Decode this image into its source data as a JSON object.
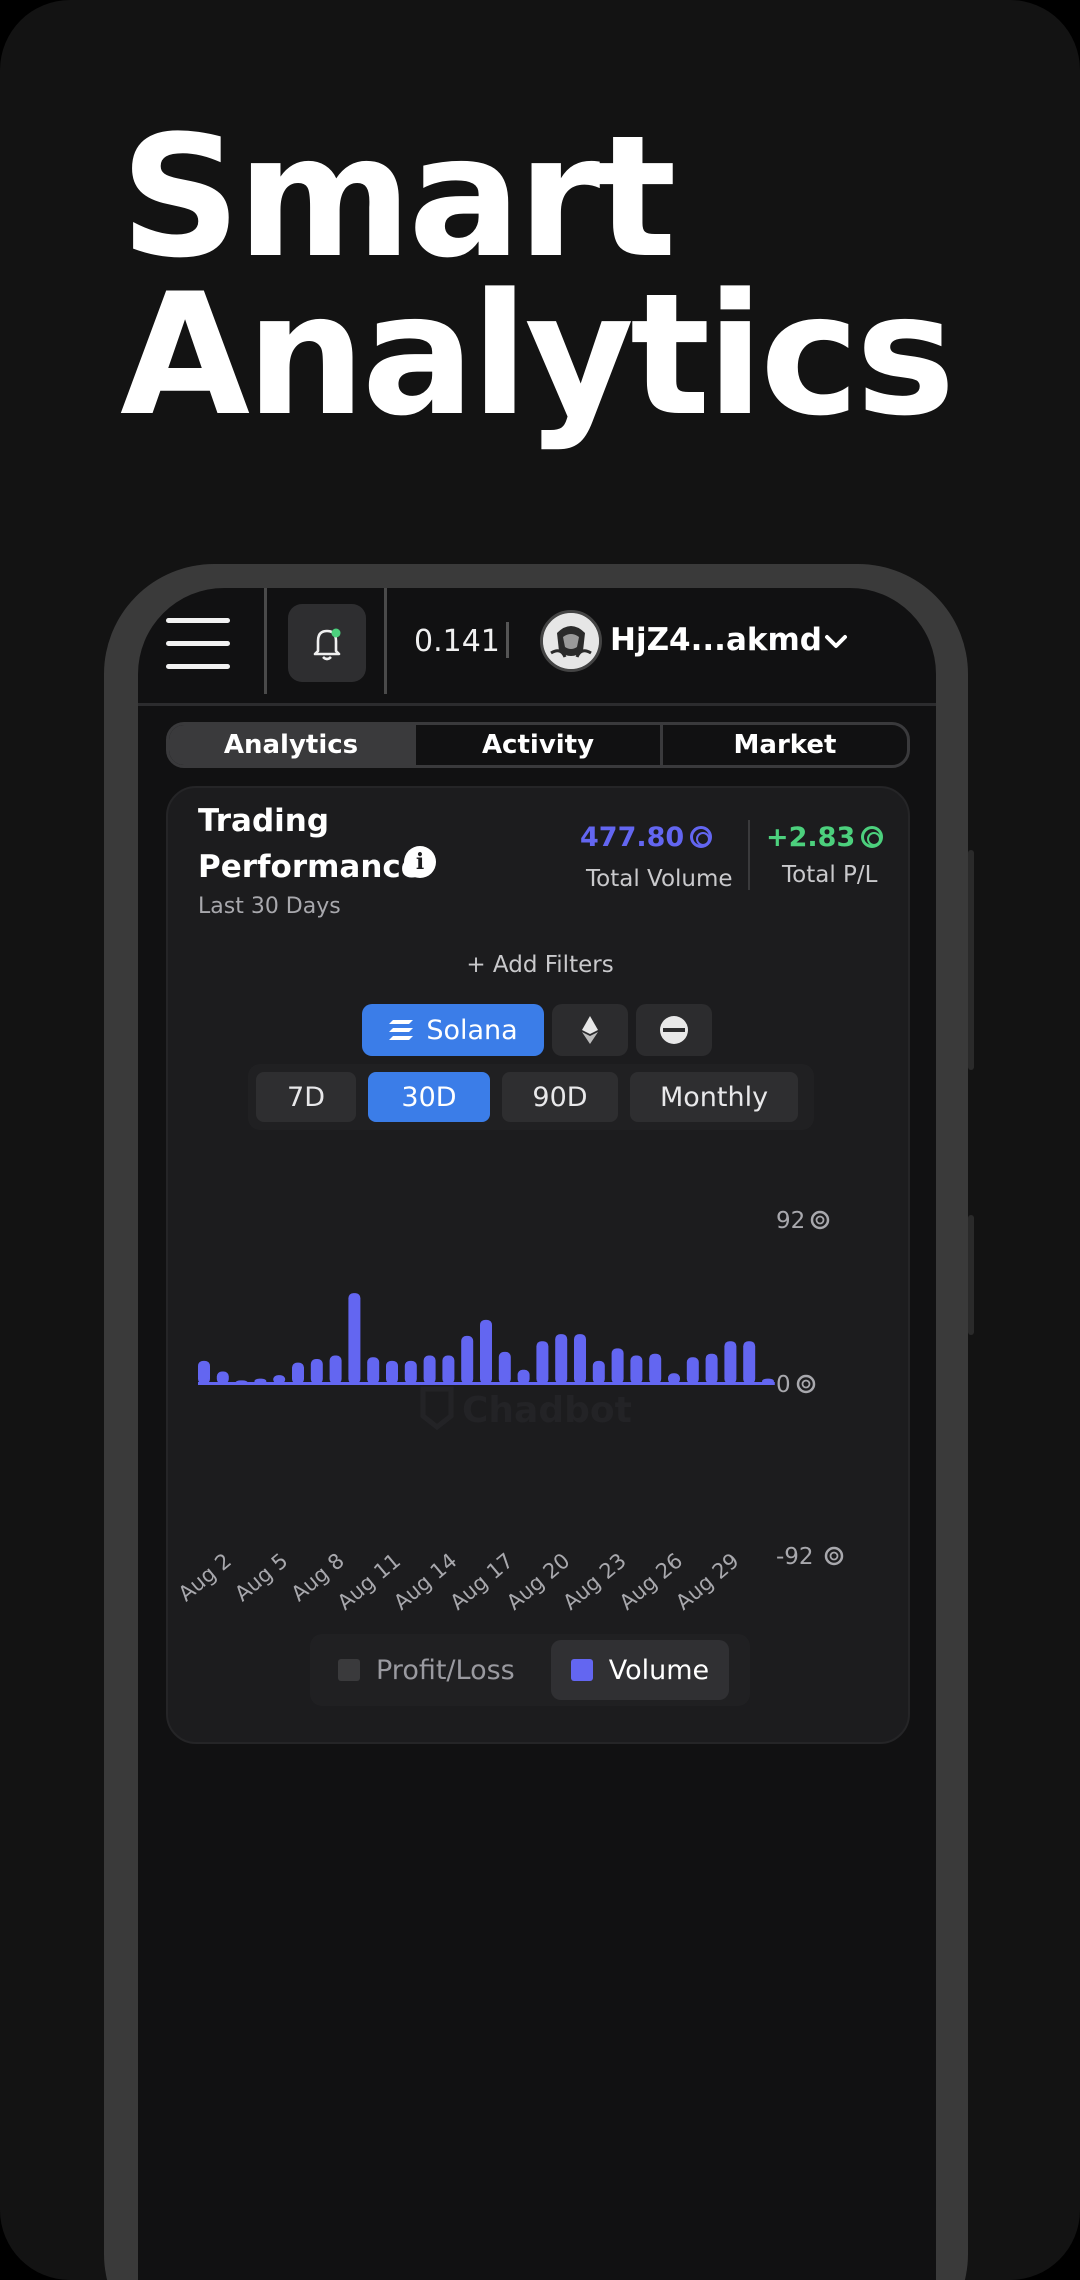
{
  "headline": {
    "line1": "Smart",
    "line2": "Analytics"
  },
  "topbar": {
    "balance": "0.141",
    "wallet": "HjZ4...akmd"
  },
  "tabs": [
    "Analytics",
    "Activity",
    "Market"
  ],
  "card": {
    "title": "Trading Performance",
    "info": "i",
    "subtitle": "Last 30 Days",
    "total_volume_value": "477.80",
    "total_volume_label": "Total Volume",
    "total_pl_value": "+2.83",
    "total_pl_label": "Total P/L",
    "add_filters": "+ Add Filters",
    "chains": [
      {
        "label": "Solana",
        "icon": "solana-icon",
        "active": true
      },
      {
        "label": "",
        "icon": "ethereum-icon",
        "active": false
      },
      {
        "label": "",
        "icon": "base-icon",
        "active": false
      }
    ],
    "ranges": [
      {
        "label": "7D",
        "active": false
      },
      {
        "label": "30D",
        "active": true
      },
      {
        "label": "90D",
        "active": false
      },
      {
        "label": "Monthly",
        "active": false
      }
    ],
    "watermark": "Chadbot"
  },
  "legend": [
    {
      "label": "Profit/Loss",
      "color": "#3a3a3c",
      "active": false
    },
    {
      "label": "Volume",
      "color": "#6366f1",
      "active": true
    }
  ],
  "colors": {
    "accent": "#3b7de8",
    "volume": "#6366f1",
    "profit": "#4cd07d"
  },
  "chart_data": {
    "type": "bar",
    "x": [
      "Aug 1",
      "Aug 2",
      "Aug 3",
      "Aug 4",
      "Aug 5",
      "Aug 6",
      "Aug 7",
      "Aug 8",
      "Aug 9",
      "Aug 10",
      "Aug 11",
      "Aug 12",
      "Aug 13",
      "Aug 14",
      "Aug 15",
      "Aug 16",
      "Aug 17",
      "Aug 18",
      "Aug 19",
      "Aug 20",
      "Aug 21",
      "Aug 22",
      "Aug 23",
      "Aug 24",
      "Aug 25",
      "Aug 26",
      "Aug 27",
      "Aug 28",
      "Aug 29",
      "Aug 30",
      "Aug 31"
    ],
    "tick_labels": [
      "Aug 2",
      "Aug 5",
      "Aug 8",
      "Aug 11",
      "Aug 14",
      "Aug 17",
      "Aug 20",
      "Aug 23",
      "Aug 26",
      "Aug 29"
    ],
    "tick_indices": [
      1,
      4,
      7,
      10,
      13,
      16,
      19,
      22,
      25,
      28
    ],
    "series": [
      {
        "name": "Volume",
        "values": [
          13,
          7,
          2,
          3,
          5,
          12,
          14,
          16,
          51,
          15,
          13,
          13,
          16,
          16,
          27,
          36,
          18,
          8,
          24,
          28,
          28,
          13,
          20,
          16,
          17,
          6,
          15,
          17,
          24,
          24,
          3
        ]
      }
    ],
    "y_ticks": [
      "92",
      "0",
      "-92"
    ],
    "ylim": [
      -92,
      92
    ]
  }
}
